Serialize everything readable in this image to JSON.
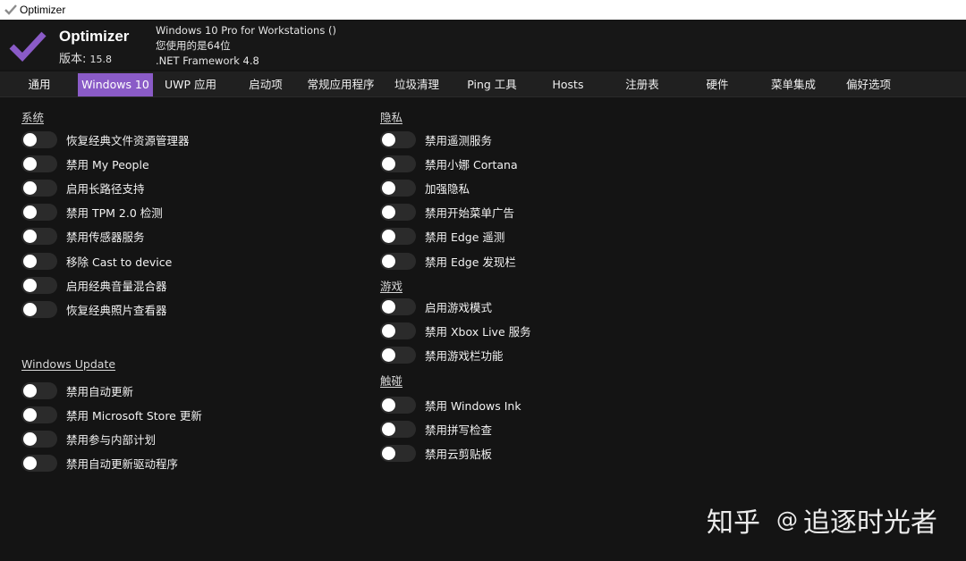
{
  "window": {
    "title": "Optimizer"
  },
  "header": {
    "app_name": "Optimizer",
    "version_label": "版本:",
    "version_number": "15.8",
    "os_line": "Windows 10 Pro for Workstations ()",
    "arch_line": "您使用的是64位",
    "framework_line": ".NET Framework 4.8",
    "accent_color": "#8a5bc7"
  },
  "tabs": [
    {
      "label": "通用",
      "active": false
    },
    {
      "label": "Windows 10",
      "active": true
    },
    {
      "label": "UWP 应用",
      "active": false
    },
    {
      "label": "启动项",
      "active": false
    },
    {
      "label": "常规应用程序",
      "active": false
    },
    {
      "label": "垃圾清理",
      "active": false
    },
    {
      "label": "Ping 工具",
      "active": false
    },
    {
      "label": "Hosts",
      "active": false
    },
    {
      "label": "注册表",
      "active": false
    },
    {
      "label": "硬件",
      "active": false
    },
    {
      "label": "菜单集成",
      "active": false
    },
    {
      "label": "偏好选项",
      "active": false
    }
  ],
  "sections": {
    "system": {
      "title": "系统",
      "options": [
        {
          "label": "恢复经典文件资源管理器",
          "on": false
        },
        {
          "label": "禁用 My People",
          "on": false
        },
        {
          "label": "启用长路径支持",
          "on": false
        },
        {
          "label": "禁用 TPM 2.0 检测",
          "on": false
        },
        {
          "label": "禁用传感器服务",
          "on": false
        },
        {
          "label": "移除 Cast to device",
          "on": false
        },
        {
          "label": "启用经典音量混合器",
          "on": false
        },
        {
          "label": "恢复经典照片查看器",
          "on": false
        }
      ]
    },
    "windows_update": {
      "title": "Windows Update",
      "options": [
        {
          "label": "禁用自动更新",
          "on": false
        },
        {
          "label": "禁用 Microsoft Store 更新",
          "on": false
        },
        {
          "label": "禁用参与内部计划",
          "on": false
        },
        {
          "label": "禁用自动更新驱动程序",
          "on": false
        }
      ]
    },
    "privacy": {
      "title": "隐私",
      "options": [
        {
          "label": "禁用遥测服务",
          "on": false
        },
        {
          "label": "禁用小娜 Cortana",
          "on": false
        },
        {
          "label": "加强隐私",
          "on": false
        },
        {
          "label": "禁用开始菜单广告",
          "on": false
        },
        {
          "label": "禁用 Edge 遥测",
          "on": false
        },
        {
          "label": "禁用 Edge 发现栏",
          "on": false
        }
      ]
    },
    "gaming": {
      "title": "游戏",
      "options": [
        {
          "label": "启用游戏模式",
          "on": false
        },
        {
          "label": "禁用 Xbox Live 服务",
          "on": false
        },
        {
          "label": "禁用游戏栏功能",
          "on": false
        }
      ]
    },
    "touch": {
      "title": "触碰",
      "options": [
        {
          "label": "禁用 Windows Ink",
          "on": false
        },
        {
          "label": "禁用拼写检查",
          "on": false
        },
        {
          "label": "禁用云剪贴板",
          "on": false
        }
      ]
    }
  },
  "watermark": {
    "platform": "知乎",
    "at": "@",
    "author": "追逐时光者"
  }
}
